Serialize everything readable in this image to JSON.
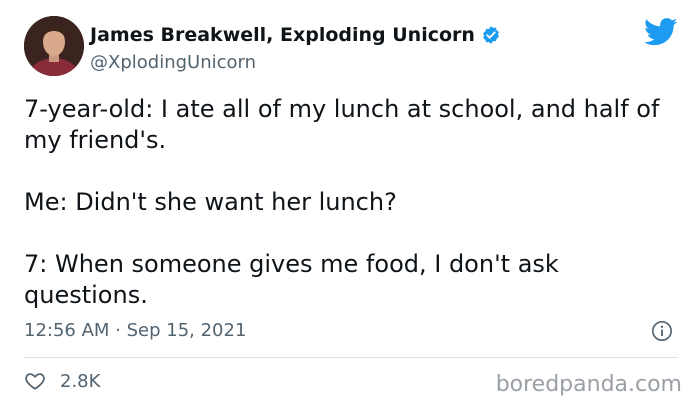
{
  "author": {
    "name": "James Breakwell, Exploding Unicorn",
    "handle": "@XplodingUnicorn",
    "verified": true
  },
  "tweet": {
    "paragraphs": [
      "7-year-old: I ate all of my lunch at school, and half of my friend's.",
      "Me: Didn't she want her lunch?",
      "7: When someone gives me food, I don't ask questions."
    ],
    "timestamp": "12:56 AM · Sep 15, 2021",
    "likes": "2.8K"
  },
  "watermark": "boredpanda.com",
  "icons": {
    "logo": "twitter-bird-icon",
    "verified": "verified-badge-icon",
    "info": "info-icon",
    "like": "heart-icon"
  },
  "colors": {
    "twitter_blue": "#1d9bf0",
    "text_primary": "#0f1419",
    "text_secondary": "#536471"
  }
}
